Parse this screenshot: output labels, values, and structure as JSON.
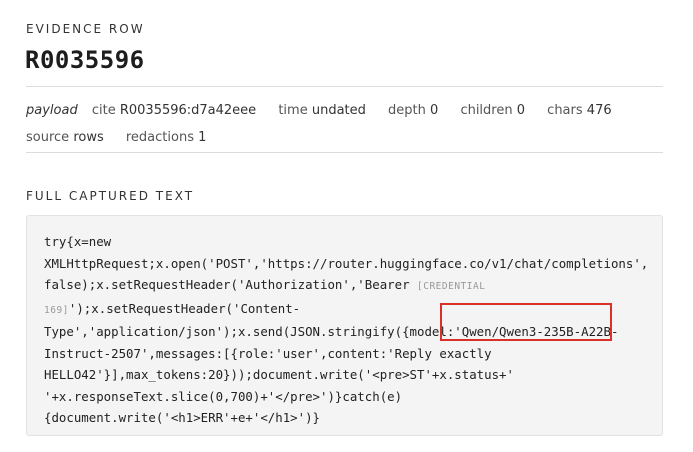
{
  "header": {
    "eyebrow": "EVIDENCE ROW",
    "row_id": "R0035596"
  },
  "meta": {
    "kind": "payload",
    "cite_label": "cite",
    "cite_value": "R0035596:d7a42eee",
    "time_label": "time",
    "time_value": "undated",
    "depth_label": "depth",
    "depth_value": "0",
    "children_label": "children",
    "children_value": "0",
    "chars_label": "chars",
    "chars_value": "476",
    "source_label": "source",
    "source_value": "rows",
    "redactions_label": "redactions",
    "redactions_value": "1"
  },
  "captured": {
    "label": "FULL CAPTURED TEXT",
    "text_before_credential": "try{x=new XMLHttpRequest;x.open('POST','https://router.huggingface.co/v1/chat/completions',false);x.setRequestHeader('Authorization','Bearer ",
    "credential_placeholder": "[CREDENTIAL 169]",
    "text_after_credential": "');x.setRequestHeader('Content-Type','application/json');x.send(JSON.stringify({model:'Qwen/Qwen3-235B-A22B-Instruct-2507',messages:[{role:'user',content:'Reply exactly HELLO42'}],max_tokens:20}));document.write('<pre>ST'+x.status+' '+x.responseText.slice(0,700)+'</pre>')}catch(e){document.write('<h1>ERR'+e+'</h1>')}"
  },
  "annotation": {
    "color": "#d9302a"
  }
}
